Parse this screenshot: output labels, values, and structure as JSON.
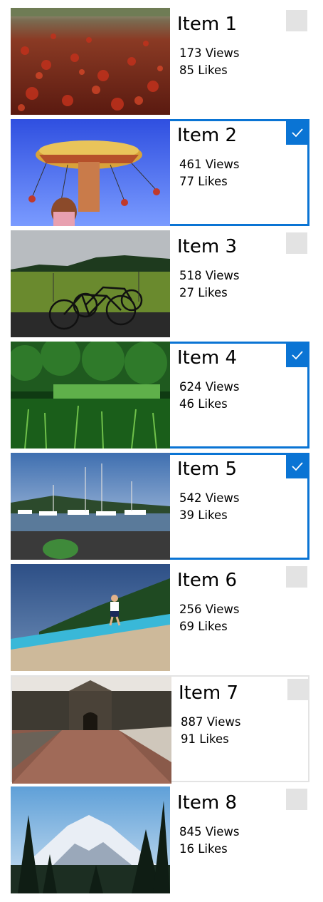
{
  "items": [
    {
      "title": "Item 1",
      "views": "173 Views",
      "likes": "85 Likes",
      "selected": false,
      "scene": "leaves"
    },
    {
      "title": "Item 2",
      "views": "461 Views",
      "likes": "77 Likes",
      "selected": true,
      "scene": "carousel"
    },
    {
      "title": "Item 3",
      "views": "518 Views",
      "likes": "27 Likes",
      "selected": false,
      "scene": "bicycle"
    },
    {
      "title": "Item 4",
      "views": "624 Views",
      "likes": "46 Likes",
      "selected": true,
      "scene": "forest-pond"
    },
    {
      "title": "Item 5",
      "views": "542 Views",
      "likes": "39 Likes",
      "selected": true,
      "scene": "marina"
    },
    {
      "title": "Item 6",
      "views": "256 Views",
      "likes": "69 Likes",
      "selected": false,
      "scene": "beach"
    },
    {
      "title": "Item 7",
      "views": "887 Views",
      "likes": "91 Likes",
      "selected": false,
      "scene": "fort"
    },
    {
      "title": "Item 8",
      "views": "845 Views",
      "likes": "16 Likes",
      "selected": false,
      "scene": "mountain"
    }
  ],
  "colors": {
    "accent": "#0a74d4",
    "checkbox_unchecked": "#e3e3e3",
    "background": "#ffffff"
  },
  "icons": {
    "checkmark": "checkmark-icon"
  }
}
